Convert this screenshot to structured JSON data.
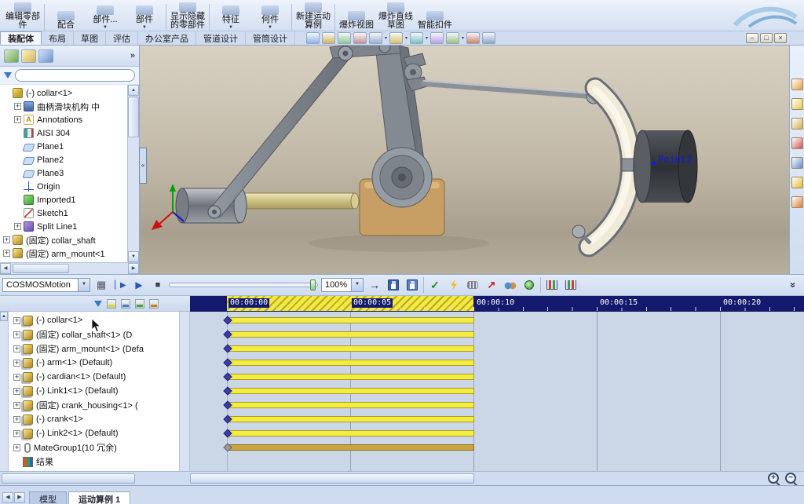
{
  "window_controls": {
    "minimize": "–",
    "restore": "□",
    "close": "×"
  },
  "ribbon": {
    "buttons": [
      {
        "label": "编辑零部件",
        "dropdown": false
      },
      {
        "label": "配合",
        "dropdown": false
      },
      {
        "label": "部件...",
        "dropdown": true
      },
      {
        "label": "部件",
        "dropdown": true
      },
      {
        "label": "显示隐藏的零部件",
        "dropdown": false
      },
      {
        "label": "特征",
        "dropdown": true
      },
      {
        "label": "何件",
        "dropdown": true
      },
      {
        "label": "新建运动算例",
        "dropdown": false
      },
      {
        "label": "爆炸视图",
        "dropdown": false
      },
      {
        "label": "爆炸直线草图",
        "dropdown": false
      },
      {
        "label": "智能扣件",
        "dropdown": false
      }
    ]
  },
  "tabs": {
    "items": [
      "装配体",
      "布局",
      "草图",
      "评估",
      "办公室产品",
      "管道设计",
      "管筒设计"
    ],
    "active": "装配体"
  },
  "view_icons": [
    "select-arrow-icon",
    "zoom-fit-icon",
    "zoom-area-icon",
    "previous-view-icon",
    "section-view-icon",
    "view-orientation-icon",
    "display-style-icon",
    "hide-show-items-icon",
    "edit-appearance-icon",
    "apply-scene-icon",
    "view-settings-icon"
  ],
  "feature_tree": {
    "items": [
      {
        "icon": "assembly",
        "label": "(-) collar<1>",
        "plus": false,
        "indent": 0
      },
      {
        "icon": "folder",
        "label": "曲柄滑块机构 中",
        "plus": true,
        "indent": 1
      },
      {
        "icon": "annotations",
        "label": "Annotations",
        "plus": true,
        "indent": 1
      },
      {
        "icon": "material",
        "label": "AISI 304",
        "plus": false,
        "indent": 1
      },
      {
        "icon": "plane",
        "label": "Plane1",
        "plus": false,
        "indent": 1
      },
      {
        "icon": "plane",
        "label": "Plane2",
        "plus": false,
        "indent": 1
      },
      {
        "icon": "plane",
        "label": "Plane3",
        "plus": false,
        "indent": 1
      },
      {
        "icon": "origin",
        "label": "Origin",
        "plus": false,
        "indent": 1
      },
      {
        "icon": "imported",
        "label": "Imported1",
        "plus": false,
        "indent": 1
      },
      {
        "icon": "sketch",
        "label": "Sketch1",
        "plus": false,
        "indent": 1
      },
      {
        "icon": "splitline",
        "label": "Split Line1",
        "plus": true,
        "indent": 1
      },
      {
        "icon": "part",
        "label": "(固定) collar_shaft",
        "plus": true,
        "indent": 0
      },
      {
        "icon": "part",
        "label": "(固定) arm_mount<1",
        "plus": true,
        "indent": 0
      }
    ]
  },
  "task_icons": [
    "solidworks-resources-icon",
    "design-library-icon",
    "file-explorer-icon",
    "search-icon",
    "view-palette-icon",
    "appearances-icon",
    "custom-properties-icon"
  ],
  "viewport": {
    "annotation": "Point2"
  },
  "motion": {
    "study_type": "COSMOSMotion",
    "zoom": "100%",
    "ruler": [
      "00:00:00",
      "00:00:05",
      "00:00:10",
      "00:00:15",
      "00:00:20"
    ],
    "rows": [
      {
        "label": "(-) collar<1>",
        "plus": true,
        "icon": "component",
        "bar": "yellow",
        "diamond": true
      },
      {
        "label": "(固定) collar_shaft<1> (D",
        "plus": true,
        "icon": "component",
        "bar": "yellow",
        "diamond": true
      },
      {
        "label": "(固定) arm_mount<1> (Defa",
        "plus": true,
        "icon": "component",
        "bar": "yellow",
        "diamond": true
      },
      {
        "label": "(-) arm<1> (Default)",
        "plus": true,
        "icon": "component",
        "bar": "yellow",
        "diamond": true
      },
      {
        "label": "(-) cardian<1> (Default)",
        "plus": true,
        "icon": "component",
        "bar": "yellow",
        "diamond": true
      },
      {
        "label": "(-) Link1<1> (Default)",
        "plus": true,
        "icon": "component",
        "bar": "yellow",
        "diamond": true
      },
      {
        "label": "(固定) crank_housing<1> (",
        "plus": true,
        "icon": "component",
        "bar": "yellow",
        "diamond": true
      },
      {
        "label": "(-) crank<1>",
        "plus": true,
        "icon": "component",
        "bar": "yellow",
        "diamond": true
      },
      {
        "label": "(-) Link2<1> (Default)",
        "plus": true,
        "icon": "component",
        "bar": "yellow",
        "diamond": true
      },
      {
        "label": "MateGroup1(10 冗余)",
        "plus": true,
        "icon": "mategroup",
        "bar": "gold",
        "diamond": true
      },
      {
        "label": "结果",
        "plus": false,
        "icon": "results",
        "bar": null,
        "diamond": false
      }
    ]
  },
  "status_bar": {
    "tabs": [
      "模型",
      "运动算例 1"
    ],
    "active": "运动算例 1"
  },
  "colors": {
    "timeline_bar": "#f4ec3e",
    "timeline_bar_gold": "#c9a53b",
    "ruler_bg": "#131a6e",
    "keyframe": "#3b3bae",
    "accent_yellow_hatch": "#b6a72e"
  }
}
